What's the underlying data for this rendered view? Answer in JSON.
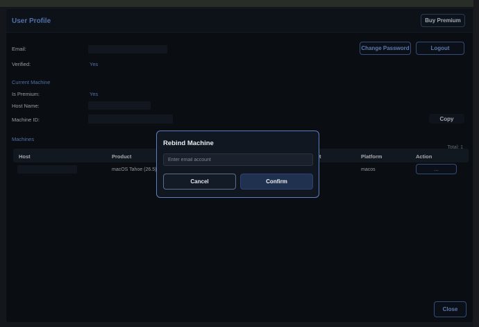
{
  "header": {
    "title": "User Profile",
    "buy_premium_label": "Buy Premium"
  },
  "account": {
    "email_label": "Email:",
    "verified_label": "Verified:",
    "verified_value": "Yes",
    "change_password_label": "Change Password",
    "logout_label": "Logout"
  },
  "current_machine": {
    "section_title": "Current Machine",
    "is_premium_label": "Is Premium:",
    "is_premium_value": "Yes",
    "host_name_label": "Host Name:",
    "machine_id_label": "Machine ID:",
    "copy_label": "Copy"
  },
  "machines": {
    "section_title": "Machines",
    "total_label": "Total: 1",
    "columns": {
      "host": "Host",
      "product": "Product",
      "last": "t",
      "platform": "Platform",
      "action": "Action"
    },
    "rows": [
      {
        "product": "macOS Tahoe (26.5)",
        "platform": "macos",
        "action": "..."
      }
    ]
  },
  "modal": {
    "title": "Rebind Machine",
    "input_placeholder": "Enter email account",
    "cancel_label": "Cancel",
    "confirm_label": "Confirm"
  },
  "footer": {
    "close_label": "Close"
  },
  "colors": {
    "accent": "#6f9ae8",
    "background": "#0f141b",
    "modal_border": "#5f7fc4"
  }
}
